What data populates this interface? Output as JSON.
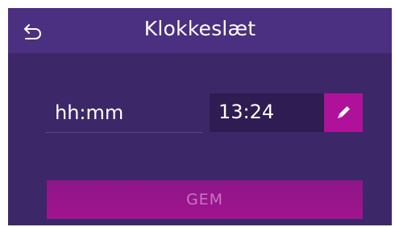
{
  "header": {
    "title": "Klokkeslæt",
    "back_icon": "undo-arrow-icon"
  },
  "form": {
    "label": "hh:mm",
    "time_value": "13:24",
    "edit_icon": "pencil-icon"
  },
  "save_button": {
    "label": "GEM",
    "state": "disabled"
  },
  "colors": {
    "background": "#3c2768",
    "header": "#4b2f80",
    "field": "#2f1c52",
    "accent": "#b0119a",
    "save_button": "#9a1490",
    "save_label_disabled": "#c974c6"
  }
}
